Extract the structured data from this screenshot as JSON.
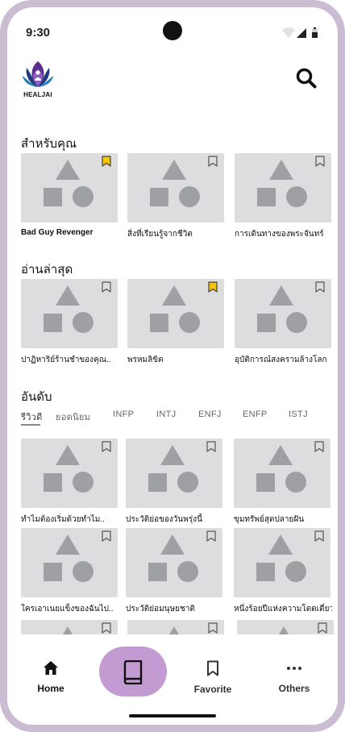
{
  "status_bar": {
    "time": "9:30"
  },
  "header": {
    "logo_text": "HEALJAI",
    "search_icon": "search-icon"
  },
  "sections": {
    "for_you": {
      "title": "สำหรับคุณ",
      "items": [
        {
          "title": "Bad Guy Revenger",
          "bookmarked": true,
          "bold": true
        },
        {
          "title": "สิ่งที่เรียนรู้จากชีวิต",
          "bookmarked": false
        },
        {
          "title": "การเดินทางของพระจันทร์",
          "bookmarked": false
        }
      ]
    },
    "recent": {
      "title": "อ่านล่าสุด",
      "items": [
        {
          "title": "ปาฏิหาริย์ร้านชำของคุณ..",
          "bookmarked": false
        },
        {
          "title": "พรหมลิขิต",
          "bookmarked": true
        },
        {
          "title": "อุบัติการณ์สงครามล้างโลก",
          "bookmarked": false
        }
      ]
    },
    "ranking": {
      "title": "อันดับ",
      "tabs": [
        "รีวิวดี",
        "ยอดนิยม",
        "INFP",
        "INTJ",
        "ENFJ",
        "ENFP",
        "ISTJ"
      ],
      "active_tab": "รีวิวดี",
      "items": [
        {
          "title": "ทำไมต้องเริ่มด้วยทำไม..",
          "bookmarked": false
        },
        {
          "title": "ประวัติย่อของวันพรุ่งนี้",
          "bookmarked": false
        },
        {
          "title": "ขุมทรัพย์สุดปลายฝัน",
          "bookmarked": false
        },
        {
          "title": "ใครเอาเนยแข็งของฉันไป..",
          "bookmarked": false
        },
        {
          "title": "ประวัติย่อมนุษยชาติ",
          "bookmarked": false
        },
        {
          "title": "หนึ่งร้อยปีแห่งความโดดเดี่ยว",
          "bookmarked": false
        }
      ]
    }
  },
  "bottom_nav": {
    "home": "Home",
    "library_icon": "book-icon",
    "favorite": "Favorite",
    "others": "Others"
  },
  "colors": {
    "bookmark_active": "#f5c400",
    "placeholder_bg": "#dddde0",
    "placeholder_shape": "#9ea0a3",
    "center_button": "#c39bd3",
    "device_frame": "#c9bcd3"
  }
}
